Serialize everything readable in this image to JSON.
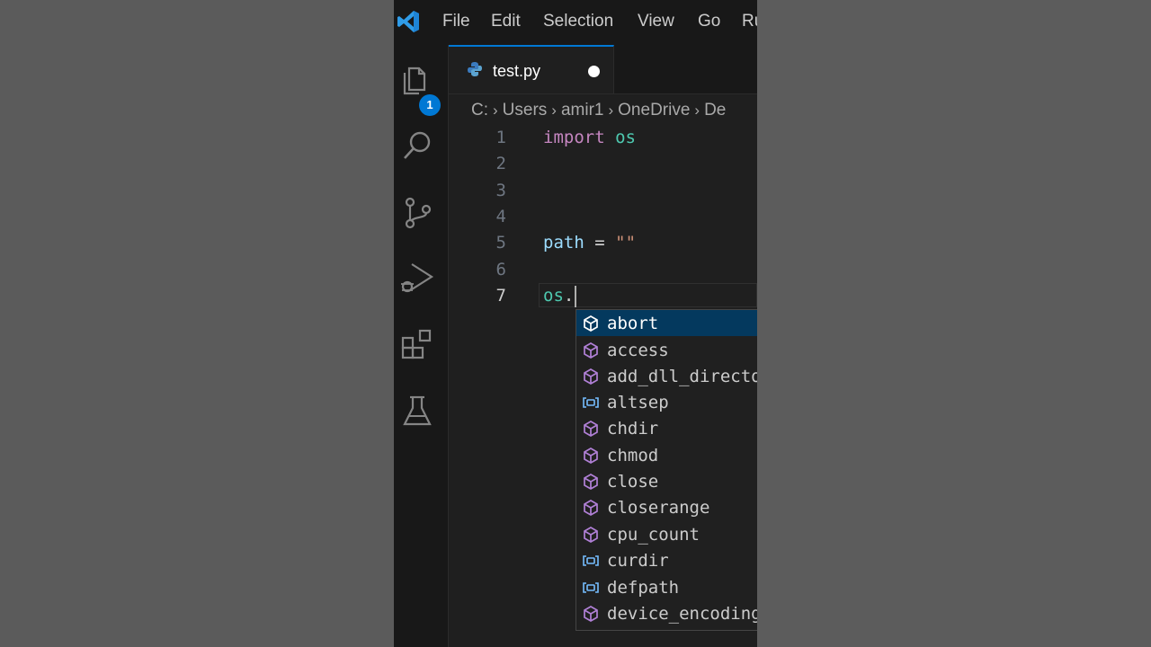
{
  "menu": {
    "items": [
      "File",
      "Edit",
      "Selection",
      "View",
      "Go",
      "Ru"
    ]
  },
  "activity_bar": {
    "explorer_badge": "1",
    "icons": [
      "files-icon",
      "search-icon",
      "source-control-icon",
      "run-debug-icon",
      "extensions-icon",
      "testing-icon"
    ]
  },
  "tab": {
    "label": "test.py",
    "icon": "python-icon",
    "dirty": true
  },
  "breadcrumb": [
    "C:",
    "Users",
    "amir1",
    "OneDrive",
    "De"
  ],
  "editor": {
    "line_numbers": [
      "1",
      "2",
      "3",
      "4",
      "5",
      "6",
      "7"
    ],
    "active_line": "7",
    "line1": {
      "keyword": "import",
      "module": "os"
    },
    "line5": {
      "var": "path",
      "op": "=",
      "str": "\"\""
    },
    "line7": {
      "module": "os",
      "dot": "."
    }
  },
  "suggestions": [
    {
      "label": "abort",
      "kind": "method",
      "selected": true
    },
    {
      "label": "access",
      "kind": "method"
    },
    {
      "label": "add_dll_directo",
      "kind": "method"
    },
    {
      "label": "altsep",
      "kind": "variable"
    },
    {
      "label": "chdir",
      "kind": "method"
    },
    {
      "label": "chmod",
      "kind": "method"
    },
    {
      "label": "close",
      "kind": "method"
    },
    {
      "label": "closerange",
      "kind": "method"
    },
    {
      "label": "cpu_count",
      "kind": "method"
    },
    {
      "label": "curdir",
      "kind": "variable"
    },
    {
      "label": "defpath",
      "kind": "variable"
    },
    {
      "label": "device_encoding",
      "kind": "method"
    }
  ],
  "colors": {
    "accent": "#0078d4",
    "keyword": "#c586c0",
    "module": "#4ec9b0",
    "variable": "#9cdcfe",
    "string": "#ce9178",
    "method_icon": "#b180d7",
    "variable_icon": "#75beff"
  }
}
